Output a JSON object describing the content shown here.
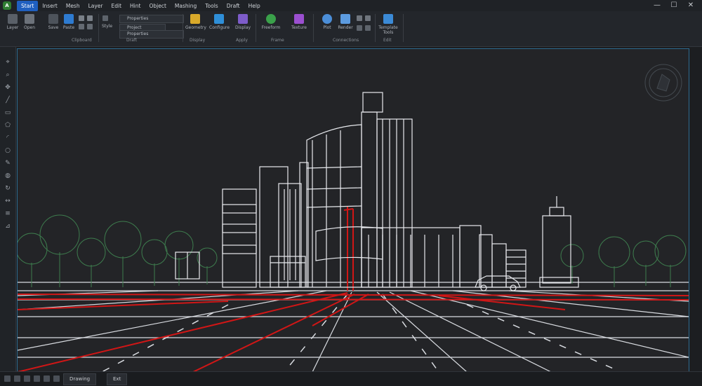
{
  "app": {
    "logo_text": "A",
    "active_tab": "Start",
    "menu": [
      "Start",
      "Insert",
      "Mesh",
      "Layer",
      "Edit",
      "Hint",
      "Object",
      "Mashing",
      "Tools",
      "Draft",
      "Help"
    ]
  },
  "window_controls": {
    "minimize": "—",
    "maximize": "☐",
    "close": "✕"
  },
  "ribbon": {
    "groups": [
      {
        "label": "Clipboard"
      },
      {
        "label": "Draft"
      },
      {
        "label": "Edit"
      },
      {
        "label": "Display"
      },
      {
        "label": "Apply"
      },
      {
        "label": "Frame"
      },
      {
        "label": "Connections"
      },
      {
        "label": "Edit"
      }
    ],
    "buttons": {
      "new": "Layer",
      "open": "Open",
      "save": "Save",
      "paste": "Paste",
      "style": "Style",
      "geometry": "Geometry",
      "configure": "Configure",
      "display": "Display",
      "freeform": "Freeform",
      "texture": "Texture",
      "plot": "Plot",
      "render": "Render",
      "template_tools": "Template Tools"
    },
    "combos": {
      "first": "Properties",
      "second": "Project",
      "third": "Properties"
    }
  },
  "status": {
    "tab": "Drawing",
    "tab2": "Ext"
  },
  "colors": {
    "accent": "#1f5fbf",
    "viewport_border": "#2d6a8f",
    "line_white": "#e8eaee",
    "line_red": "#d11616",
    "tree": "#3e7d4e"
  }
}
